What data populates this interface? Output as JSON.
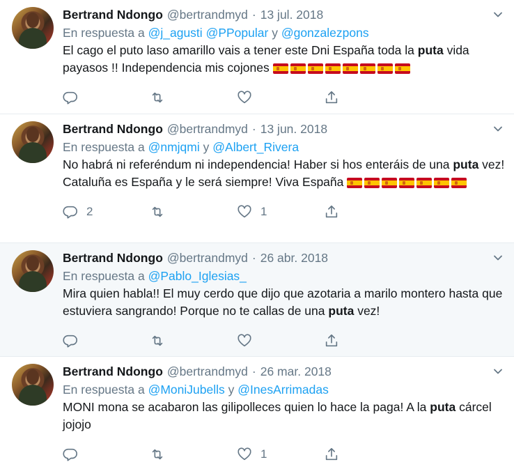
{
  "reply_prefix": "En respuesta a",
  "conj": "y",
  "tweets": [
    {
      "name": "Bertrand Ndongo",
      "handle": "@bertrandmyd",
      "date": "13 jul. 2018",
      "reply_mentions": [
        "@j_agusti",
        "@PPopular",
        "@gonzalezpons"
      ],
      "text_parts": [
        "El cago el puto laso amarillo vais a tener este Dni España toda la ",
        "puta",
        " vida payasos !! Independencia mis cojones "
      ],
      "flag_count": 8,
      "reply_count": "",
      "like_count": ""
    },
    {
      "name": "Bertrand Ndongo",
      "handle": "@bertrandmyd",
      "date": "13 jun. 2018",
      "reply_mentions": [
        "@nmjqmi",
        "@Albert_Rivera"
      ],
      "text_parts": [
        "No habrá ni referéndum ni independencia! Haber si hos enteráis de una ",
        "puta",
        " vez! Cataluña es España y le será siempre! Viva España "
      ],
      "flag_count": 7,
      "reply_count": "2",
      "like_count": "1"
    },
    {
      "name": "Bertrand Ndongo",
      "handle": "@bertrandmyd",
      "date": "26 abr. 2018",
      "reply_mentions": [
        "@Pablo_Iglesias_"
      ],
      "text_parts": [
        "Mira quien habla!! El muy cerdo que dijo que azotaria a marilo montero hasta que estuviera sangrando! Porque no te callas de una ",
        "puta",
        " vez!"
      ],
      "flag_count": 0,
      "reply_count": "",
      "like_count": ""
    },
    {
      "name": "Bertrand Ndongo",
      "handle": "@bertrandmyd",
      "date": "26 mar. 2018",
      "reply_mentions": [
        "@MoniJubells",
        "@InesArrimadas"
      ],
      "text_parts": [
        "MONI mona se acabaron las gilipolleces quien lo hace la paga! A la ",
        "puta",
        " cárcel jojojo"
      ],
      "flag_count": 0,
      "reply_count": "",
      "like_count": "1"
    }
  ],
  "icons": {
    "reply": "reply-icon",
    "retweet": "retweet-icon",
    "like": "like-icon",
    "share": "share-icon",
    "more": "chevron-down-icon",
    "flag": "spain-flag-icon"
  },
  "colors": {
    "mention": "#1da1f2",
    "secondary": "#657786",
    "hover_bg": "#f5f8fa"
  }
}
